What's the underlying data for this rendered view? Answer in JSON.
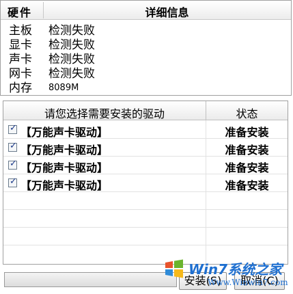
{
  "hardware": {
    "header": {
      "col_hardware": "硬件",
      "col_details": "详细信息"
    },
    "rows": [
      {
        "label": "主板",
        "value": "检测失败"
      },
      {
        "label": "显卡",
        "value": "检测失败"
      },
      {
        "label": "声卡",
        "value": "检测失败"
      },
      {
        "label": "网卡",
        "value": "检测失败"
      },
      {
        "label": "内存",
        "value": "8089M"
      }
    ]
  },
  "drivers": {
    "header": {
      "col_select": "请您选择需要安装的驱动",
      "col_status": "状态"
    },
    "rows": [
      {
        "checked": true,
        "name": "【万能声卡驱动】",
        "status": "准备安装"
      },
      {
        "checked": true,
        "name": "【万能声卡驱动】",
        "status": "准备安装"
      },
      {
        "checked": true,
        "name": "【万能声卡驱动】",
        "status": "准备安装"
      },
      {
        "checked": true,
        "name": "【万能声卡驱动】",
        "status": "准备安装"
      }
    ]
  },
  "buttons": {
    "install": "安装(S)",
    "cancel": "取消(C)"
  },
  "watermark": {
    "brand": "Win7系统之家",
    "url": "Www.Winwin7.com"
  },
  "colors": {
    "accent": "#1e6fd0",
    "check": "#1c3a8a"
  }
}
